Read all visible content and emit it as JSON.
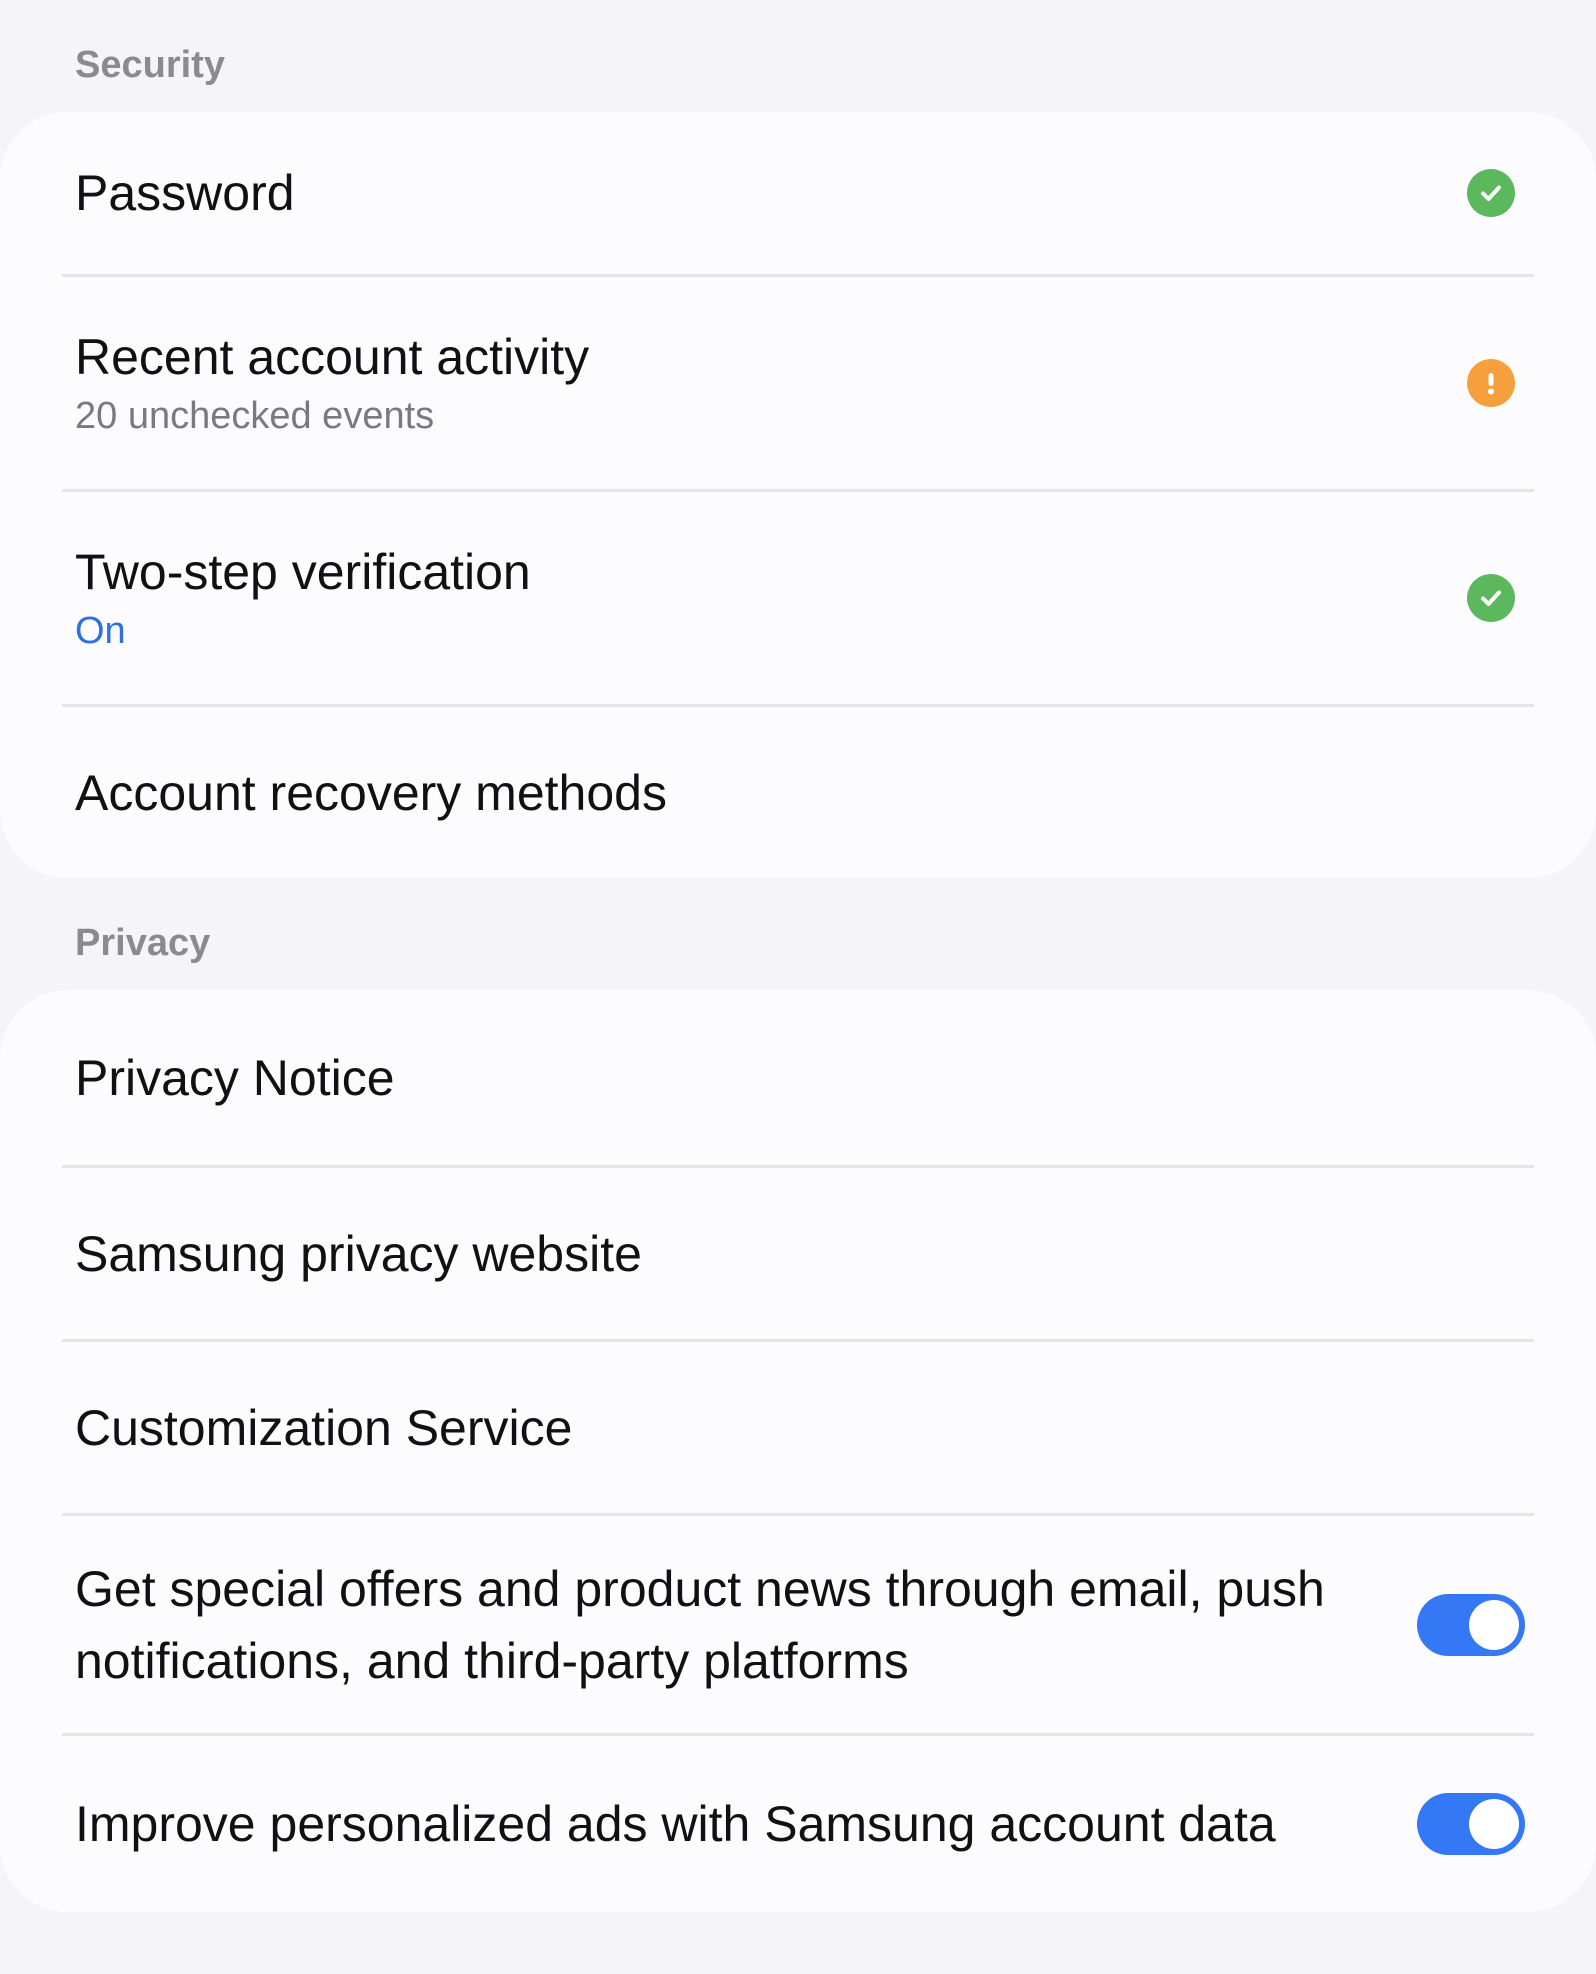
{
  "colors": {
    "background": "#f5f5f7",
    "card": "#fcfcfe",
    "ok": "#5cb85c",
    "warning": "#f5a03c",
    "accent": "#3478f6",
    "on_text": "#2f6fde"
  },
  "security": {
    "header": "Security",
    "items": [
      {
        "title": "Password",
        "subtitle": "",
        "status_icon": "check-circle-icon"
      },
      {
        "title": "Recent account activity",
        "subtitle": "20 unchecked events",
        "status_icon": "warning-circle-icon"
      },
      {
        "title": "Two-step verification",
        "subtitle": "On",
        "status_icon": "check-circle-icon"
      },
      {
        "title": "Account recovery methods",
        "subtitle": ""
      }
    ]
  },
  "privacy": {
    "header": "Privacy",
    "items": [
      {
        "title": "Privacy Notice"
      },
      {
        "title": "Samsung privacy website"
      },
      {
        "title": "Customization Service"
      },
      {
        "title": "Get special offers and product news through email, push notifications, and third-party platforms",
        "toggle_on": true
      },
      {
        "title": "Improve personalized ads with Samsung account data",
        "toggle_on": true
      }
    ]
  }
}
